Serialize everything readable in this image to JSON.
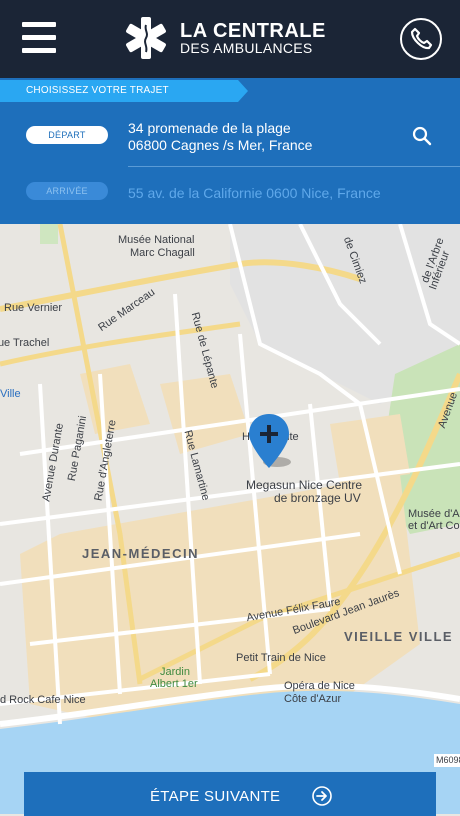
{
  "header": {
    "brand_line1": "LA CENTRALE",
    "brand_line2": "DES AMBULANCES",
    "icons": [
      "menu-icon",
      "star-of-life-icon",
      "phone-icon"
    ]
  },
  "trip": {
    "section_label": "CHOISISSEZ VOTRE TRAJET",
    "departure_label": "DÉPART",
    "departure_line1": "34 promenade de la plage",
    "departure_line2": "06800 Cagnes /s Mer, France",
    "arrival_label": "ARRIVÉE",
    "arrival_placeholder": "55 av. de la Californie 0600 Nice, France"
  },
  "map": {
    "poi": [
      "Musée National",
      "Marc Chagall",
      "Rue Vernier",
      "Rue Trachel",
      "Rue Marceau",
      "Rue de Lépante",
      "Avenue Durante",
      "Rue Paganini",
      "Rue d'Angleterre",
      "Rue Lamartine",
      "Hôtel Vante",
      "Megasun Nice Centre",
      "de bronzage UV",
      "Musée d'A",
      "et d'Art Co",
      "Avenue Félix Faure",
      "Boulevard Jean Jaurès",
      "Petit Train de Nice",
      "Jardin",
      "Albert 1er",
      "Opéra de Nice",
      "Côte d'Azur",
      "d Rock Cafe Nice",
      "Ville",
      "de Cimiez",
      "de l'Arbre",
      "Inférieur",
      "Avenue",
      "M6098"
    ],
    "districts": [
      "JEAN-MÉDECIN",
      "VIEILLE VILLE"
    ]
  },
  "cta": {
    "label": "ÉTAPE SUIVANTE"
  }
}
